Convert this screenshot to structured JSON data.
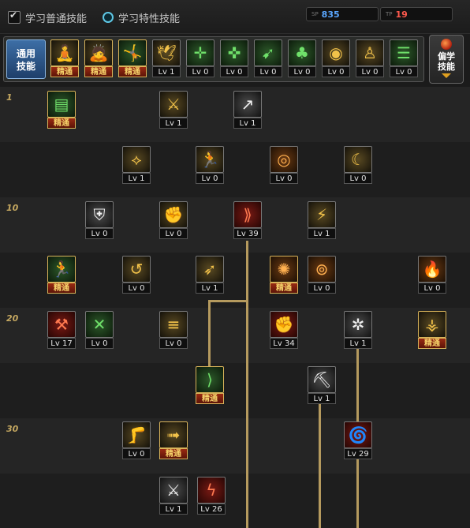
{
  "topbar": {
    "mode_common": "学习普通技能",
    "mode_trait": "学习特性技能",
    "sp_tag": "SP",
    "sp_value": "835",
    "tp_tag": "TP",
    "tp_value": "19"
  },
  "general": {
    "label": "通用\n技能",
    "skills": [
      {
        "icon": "stretch-icon",
        "glyph": "🧘",
        "level": "精通",
        "state": "mastered",
        "color": "gold"
      },
      {
        "icon": "kneel-icon",
        "glyph": "🙇",
        "level": "精通",
        "state": "mastered",
        "color": "gold"
      },
      {
        "icon": "leap-icon",
        "glyph": "🤸",
        "level": "精通",
        "state": "mastered",
        "color": "green"
      },
      {
        "icon": "wings-icon",
        "glyph": "🕊",
        "level": "Lv 1",
        "state": "normal",
        "color": "gold"
      },
      {
        "icon": "crosshair-icon",
        "glyph": "✛",
        "level": "Lv 0",
        "state": "normal",
        "color": "green"
      },
      {
        "icon": "crosshair-plus-icon",
        "glyph": "✜",
        "level": "Lv 0",
        "state": "normal",
        "color": "green"
      },
      {
        "icon": "dash-icon",
        "glyph": "➹",
        "level": "Lv 0",
        "state": "normal",
        "color": "green"
      },
      {
        "icon": "mushroom-icon",
        "glyph": "♣",
        "level": "Lv 0",
        "state": "normal",
        "color": "green"
      },
      {
        "icon": "eye-icon",
        "glyph": "◉",
        "level": "Lv 0",
        "state": "normal",
        "color": "gold"
      },
      {
        "icon": "muscle-icon",
        "glyph": "♙",
        "level": "Lv 0",
        "state": "normal",
        "color": "gold"
      },
      {
        "icon": "scroll-icon",
        "glyph": "☰",
        "level": "Lv 0",
        "state": "normal",
        "color": "green"
      }
    ]
  },
  "pref_button": "偏学\n技能",
  "tree": {
    "row_labels": [
      "1",
      "10",
      "20",
      "30"
    ],
    "skills": [
      {
        "icon": "tome-icon",
        "glyph": "▤",
        "level": "精通",
        "state": "mastered",
        "color": "green"
      },
      {
        "icon": "kunai-icon",
        "glyph": "⚔",
        "level": "Lv 1",
        "state": "normal",
        "color": "gold"
      },
      {
        "icon": "spear-icon",
        "glyph": "↗",
        "level": "Lv 1",
        "state": "normal",
        "color": "white"
      },
      {
        "icon": "chain-icon",
        "glyph": "⟡",
        "level": "Lv 1",
        "state": "normal",
        "color": "gold"
      },
      {
        "icon": "sprint-icon",
        "glyph": "🏃",
        "level": "Lv 0",
        "state": "normal",
        "color": "gold"
      },
      {
        "icon": "orb-icon",
        "glyph": "◎",
        "level": "Lv 0",
        "state": "normal",
        "color": "orange"
      },
      {
        "icon": "crescent-icon",
        "glyph": "☾",
        "level": "Lv 0",
        "state": "normal",
        "color": "gold"
      },
      {
        "icon": "shield-icon",
        "glyph": "⛨",
        "level": "Lv 0",
        "state": "normal",
        "color": "white"
      },
      {
        "icon": "flex-icon",
        "glyph": "✊",
        "level": "Lv 0",
        "state": "normal",
        "color": "gold"
      },
      {
        "icon": "slash-icon",
        "glyph": "⟫",
        "level": "Lv 39",
        "state": "normal",
        "color": "red"
      },
      {
        "icon": "lightning-icon",
        "glyph": "⚡",
        "level": "Lv 1",
        "state": "normal",
        "color": "gold"
      },
      {
        "icon": "runner-icon",
        "glyph": "🏃",
        "level": "精通",
        "state": "mastered",
        "color": "green"
      },
      {
        "icon": "whirl-icon",
        "glyph": "↺",
        "level": "Lv 0",
        "state": "normal",
        "color": "gold"
      },
      {
        "icon": "arrow-icon",
        "glyph": "➶",
        "level": "Lv 1",
        "state": "normal",
        "color": "gold"
      },
      {
        "icon": "burst-icon",
        "glyph": "✺",
        "level": "精通",
        "state": "mastered",
        "color": "orange"
      },
      {
        "icon": "ring-icon",
        "glyph": "⊚",
        "level": "Lv 0",
        "state": "normal",
        "color": "orange"
      },
      {
        "icon": "flame-icon",
        "glyph": "🔥",
        "level": "Lv 0",
        "state": "normal",
        "color": "orange"
      },
      {
        "icon": "cross-sword-icon",
        "glyph": "⚒",
        "level": "Lv 17",
        "state": "normal",
        "color": "red"
      },
      {
        "icon": "cross-blade-icon",
        "glyph": "✕",
        "level": "Lv 0",
        "state": "normal",
        "color": "green"
      },
      {
        "icon": "blades-icon",
        "glyph": "≡",
        "level": "Lv 0",
        "state": "normal",
        "color": "gold"
      },
      {
        "icon": "fist-icon",
        "glyph": "✊",
        "level": "Lv 34",
        "state": "normal",
        "color": "red"
      },
      {
        "icon": "vortex-icon",
        "glyph": "✲",
        "level": "Lv 1",
        "state": "normal",
        "color": "white"
      },
      {
        "icon": "blast-icon",
        "glyph": "⚶",
        "level": "精通",
        "state": "mastered",
        "color": "gold"
      },
      {
        "icon": "claw-icon",
        "glyph": "⟩",
        "level": "精通",
        "state": "mastered",
        "color": "green"
      },
      {
        "icon": "pickaxe-icon",
        "glyph": "⛏",
        "level": "Lv 1",
        "state": "normal",
        "color": "white"
      },
      {
        "icon": "kick-icon",
        "glyph": "🦵",
        "level": "Lv 0",
        "state": "normal",
        "color": "gold"
      },
      {
        "icon": "dash-strike-icon",
        "glyph": "➟",
        "level": "精通",
        "state": "mastered",
        "color": "gold"
      },
      {
        "icon": "tornado-icon",
        "glyph": "🌀",
        "level": "Lv 29",
        "state": "normal",
        "color": "red"
      },
      {
        "icon": "sword-swing-icon",
        "glyph": "⚔",
        "level": "Lv 1",
        "state": "normal",
        "color": "white"
      },
      {
        "icon": "thunder-icon",
        "glyph": "ϟ",
        "level": "Lv 26",
        "state": "normal",
        "color": "red"
      }
    ]
  }
}
